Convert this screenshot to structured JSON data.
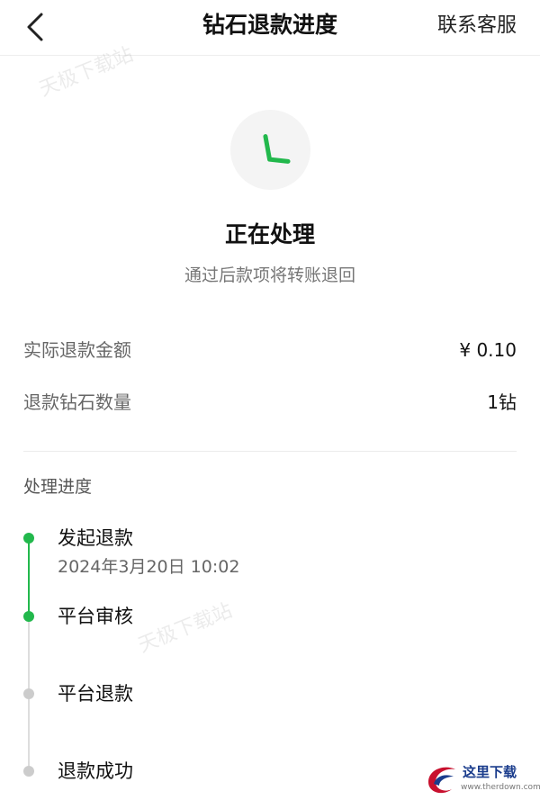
{
  "nav": {
    "title": "钻石退款进度",
    "service_label": "联系客服"
  },
  "watermarks": [
    "天极下载站",
    "天极下载站"
  ],
  "status": {
    "title": "正在处理",
    "subtitle": "通过后款项将转账退回",
    "accent": "#22b84c"
  },
  "info": {
    "amount_label": "实际退款金额",
    "amount_value": "¥ 0.10",
    "count_label": "退款钻石数量",
    "count_value": "1钻"
  },
  "progress": {
    "section_title": "处理进度",
    "steps": [
      {
        "title": "发起退款",
        "time": "2024年3月20日 10:02",
        "done": true
      },
      {
        "title": "平台审核",
        "done": true
      },
      {
        "title": "平台退款",
        "done": false
      },
      {
        "title": "退款成功",
        "done": false
      }
    ],
    "done_color": "#22b84c",
    "pending_color": "#cccccc"
  },
  "logo": {
    "text": "这里下载",
    "url": "www.therdown.com"
  }
}
